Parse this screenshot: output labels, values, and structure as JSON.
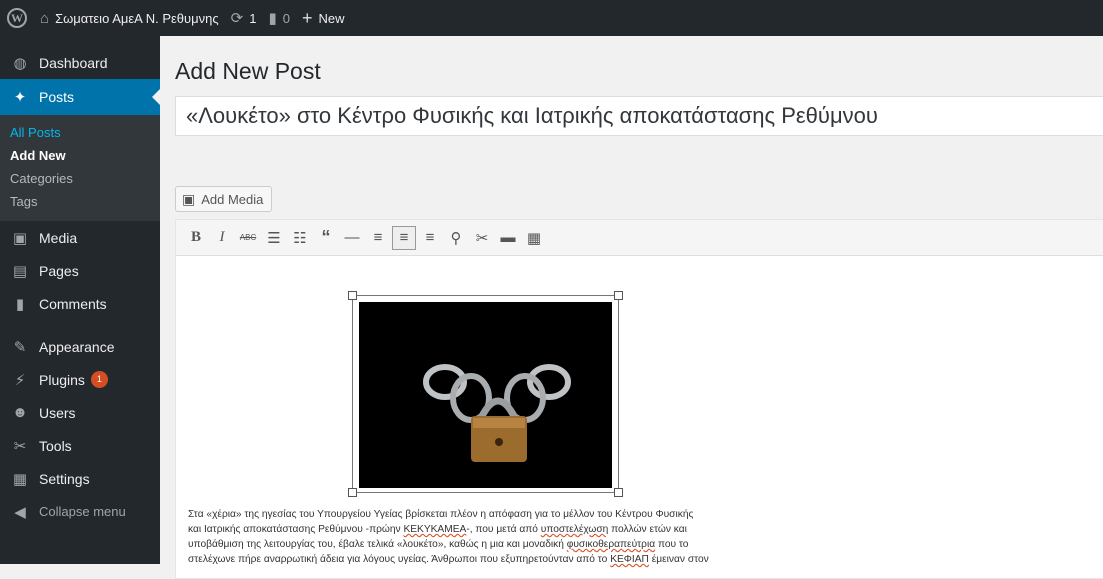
{
  "adminbar": {
    "site_name": "Σωματειο ΑμεΑ Ν. Ρεθυμνης",
    "updates_count": "1",
    "comments_count": "0",
    "new_label": "New"
  },
  "sidebar": {
    "items": [
      {
        "label": "Dashboard",
        "icon": "dashboard-icon"
      },
      {
        "label": "Posts",
        "icon": "pushpin-icon"
      },
      {
        "label": "Media",
        "icon": "media-icon"
      },
      {
        "label": "Pages",
        "icon": "pages-icon"
      },
      {
        "label": "Comments",
        "icon": "comment-icon"
      },
      {
        "label": "Appearance",
        "icon": "brush-icon"
      },
      {
        "label": "Plugins",
        "icon": "plug-icon",
        "badge": "1"
      },
      {
        "label": "Users",
        "icon": "users-icon"
      },
      {
        "label": "Tools",
        "icon": "wrench-icon"
      },
      {
        "label": "Settings",
        "icon": "settings-icon"
      }
    ],
    "posts_submenu": [
      "All Posts",
      "Add New",
      "Categories",
      "Tags"
    ],
    "collapse_label": "Collapse menu"
  },
  "main": {
    "page_title": "Add New Post",
    "post_title": "«Λουκέτο» στο Κέντρο Φυσικής και Ιατρικής αποκατάστασης Ρεθύμνου",
    "add_media_label": "Add Media",
    "toolbar": [
      "bold",
      "italic",
      "strikethrough",
      "bulleted-list",
      "numbered-list",
      "blockquote",
      "horizontal-line",
      "align-left",
      "align-center",
      "align-right",
      "insert-link",
      "remove-link",
      "read-more",
      "toolbar-toggle"
    ]
  },
  "body": {
    "l1": "Στα «χέρια» της ηγεσίας του Υπουργείου Υγείας βρίσκεται πλέον η απόφαση για το μέλλον του Κέντρου Φυσικής",
    "l2a": "και Ιατρικής αποκατάστασης Ρεθύμνου -πρώην ",
    "l2b": "ΚΕΚΥΚΑΜΕΑ",
    "l2c": "-, που μετά από ",
    "l2d": "υποστελέχωση",
    "l2e": " πολλών ετών και",
    "l3a": "υποβάθμιση της λειτουργίας του, έβαλε τελικά «λουκέτο», καθώς η μια και μοναδική ",
    "l3b": "φυσικοθεραπεύτρια",
    "l3c": " που το",
    "l4a": "στελέχωνε πήρε αναρρωτική άδεια για λόγους υγείας. Άνθρωποι που εξυπηρετούνταν από το ",
    "l4b": "ΚΕΦΙΑΠ",
    "l4c": " έμειναν στον"
  },
  "colors": {
    "accent": "#0073aa",
    "sidebar": "#23282d",
    "badge": "#d54e21"
  }
}
